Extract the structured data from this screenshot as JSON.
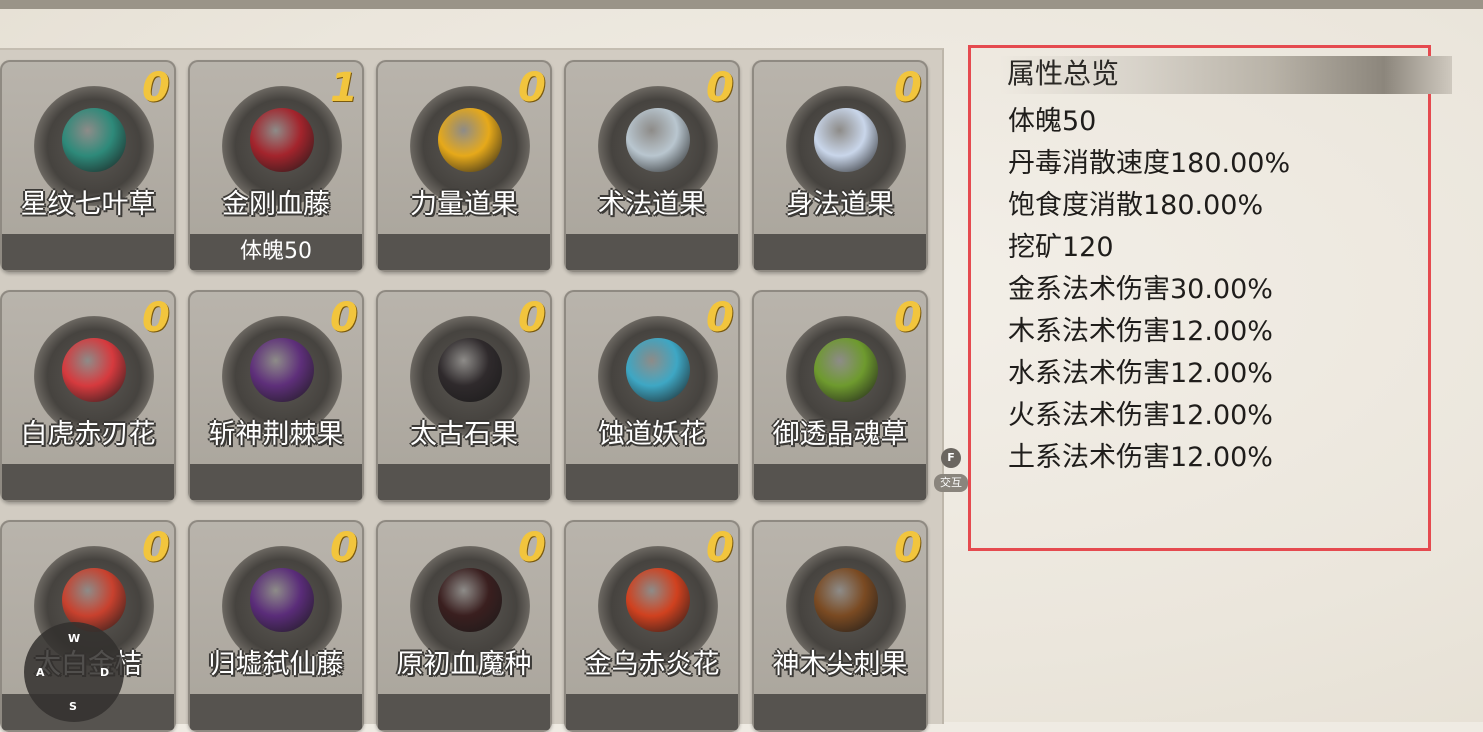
{
  "attributes": {
    "title": "属性总览",
    "lines": [
      "体魄50",
      "丹毒消散速度180.00%",
      "饱食度消散180.00%",
      "挖矿120",
      "金系法术伤害30.00%",
      "木系法术伤害12.00%",
      "水系法术伤害12.00%",
      "火系法术伤害12.00%",
      "土系法术伤害12.00%"
    ]
  },
  "items": [
    {
      "name": "星纹七叶草",
      "count": "0",
      "bonus": "",
      "color": "#2e8a7a"
    },
    {
      "name": "金刚血藤",
      "count": "1",
      "bonus": "体魄50",
      "color": "#a3242c"
    },
    {
      "name": "力量道果",
      "count": "0",
      "bonus": "",
      "color": "#e6a91a"
    },
    {
      "name": "术法道果",
      "count": "0",
      "bonus": "",
      "color": "#b9c6cf"
    },
    {
      "name": "身法道果",
      "count": "0",
      "bonus": "",
      "color": "#c9d6ea"
    },
    {
      "name": "白虎赤刃花",
      "count": "0",
      "bonus": "",
      "color": "#d63a3e"
    },
    {
      "name": "斩神荆棘果",
      "count": "0",
      "bonus": "",
      "color": "#5e2f7a"
    },
    {
      "name": "太古石果",
      "count": "0",
      "bonus": "",
      "color": "#2f2a2c"
    },
    {
      "name": "蚀道妖花",
      "count": "0",
      "bonus": "",
      "color": "#3ea7c4"
    },
    {
      "name": "御透晶魂草",
      "count": "0",
      "bonus": "",
      "color": "#6e9a2e"
    },
    {
      "name": "太白金桔",
      "count": "0",
      "bonus": "",
      "color": "#c8412e"
    },
    {
      "name": "归墟弑仙藤",
      "count": "0",
      "bonus": "",
      "color": "#5a2c79"
    },
    {
      "name": "原初血魔种",
      "count": "0",
      "bonus": "",
      "color": "#3a1f1f"
    },
    {
      "name": "金乌赤炎花",
      "count": "0",
      "bonus": "",
      "color": "#d0411f"
    },
    {
      "name": "神木尖刺果",
      "count": "0",
      "bonus": "",
      "color": "#7a4a22"
    }
  ],
  "interact_hint": {
    "key": "F",
    "label": "交互"
  },
  "minimap": {
    "n": "W",
    "w": "A",
    "e": "D",
    "s": "S"
  }
}
